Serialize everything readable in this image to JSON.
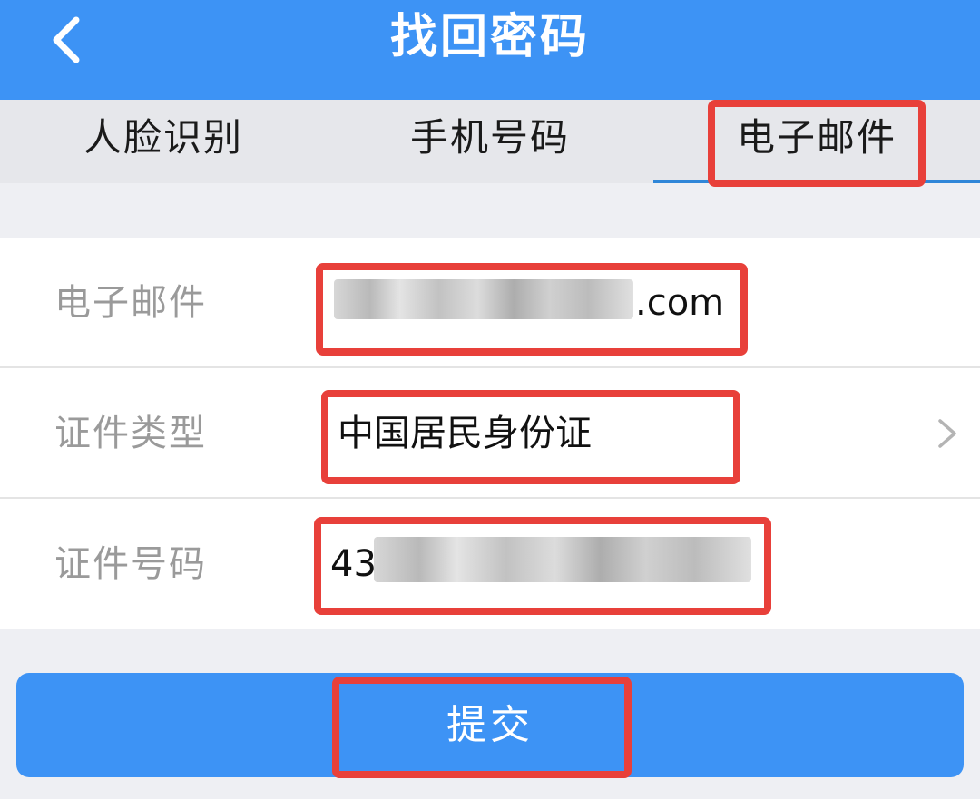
{
  "header": {
    "title": "找回密码",
    "back_icon": "chevron-left-icon"
  },
  "tabs": [
    {
      "label": "人脸识别",
      "active": false
    },
    {
      "label": "手机号码",
      "active": false
    },
    {
      "label": "电子邮件",
      "active": true
    }
  ],
  "form": {
    "email": {
      "label": "电子邮件",
      "visible_suffix": ".com"
    },
    "id_type": {
      "label": "证件类型",
      "value": "中国居民身份证",
      "chevron_icon": "chevron-right-icon"
    },
    "id_number": {
      "label": "证件号码",
      "visible_prefix": "43"
    }
  },
  "submit": {
    "label": "提交"
  },
  "colors": {
    "primary": "#3d93f5",
    "highlight": "#e8403a",
    "tab_indicator": "#2f86d8",
    "background": "#eeeff3"
  }
}
